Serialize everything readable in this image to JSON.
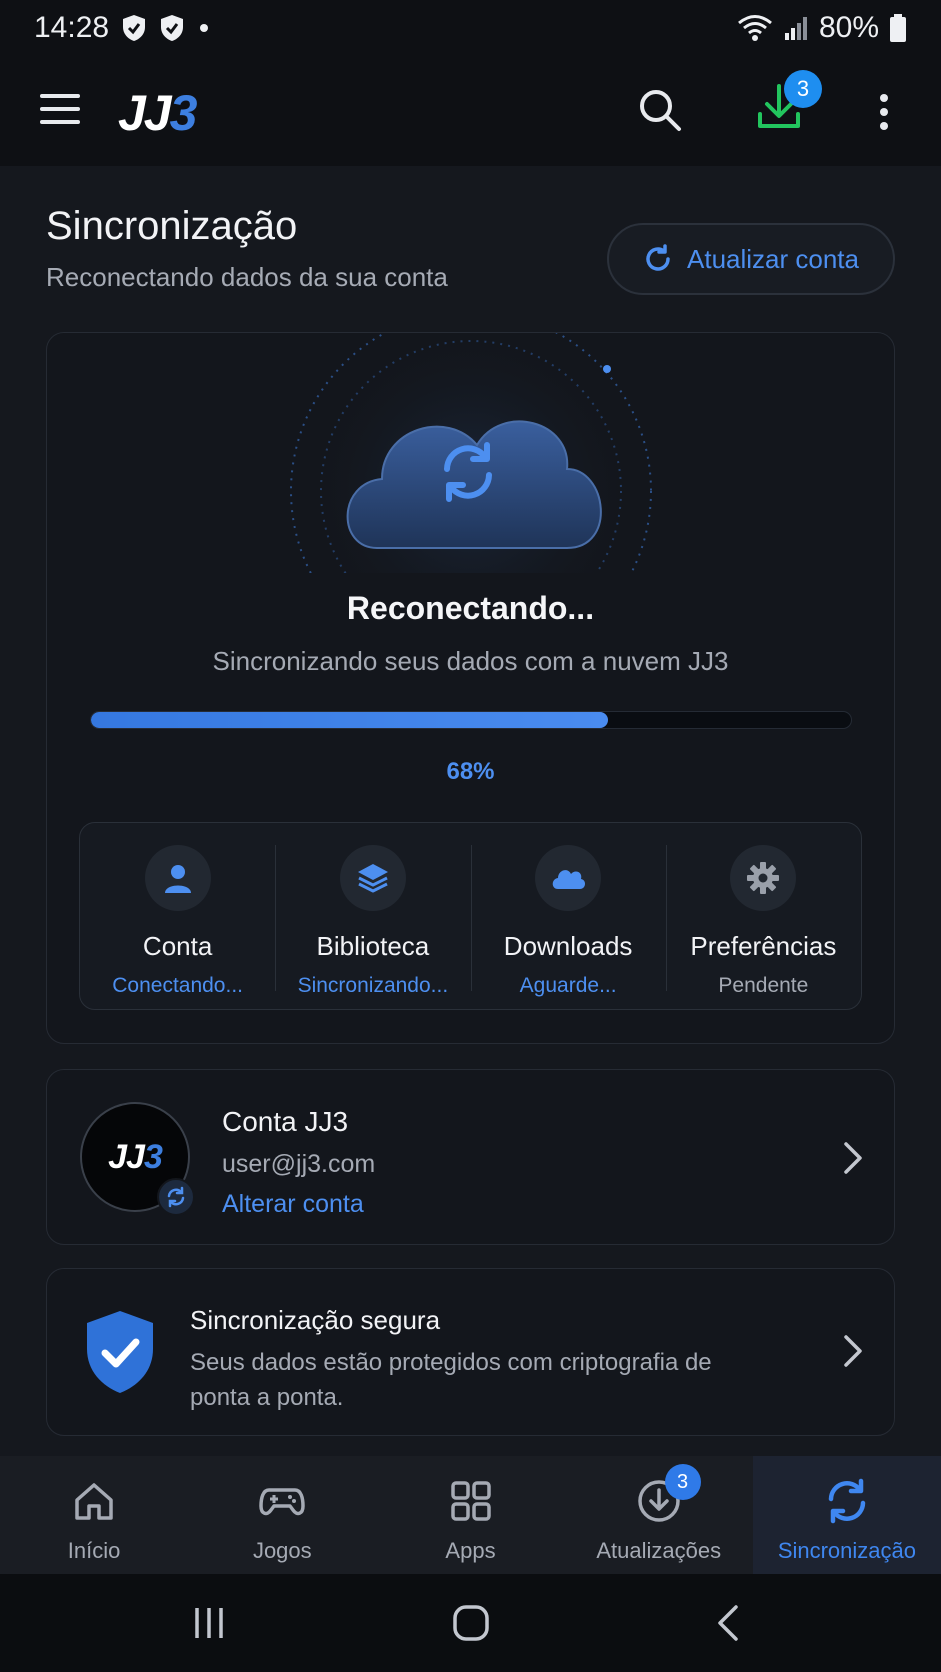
{
  "status_bar": {
    "time": "14:28",
    "battery": "80%"
  },
  "app_bar": {
    "logo_white": "JJ",
    "logo_blue": "3",
    "downloads_badge": "3"
  },
  "header": {
    "title": "Sincronização",
    "subtitle": "Reconectando dados da sua conta",
    "refresh_label": "Atualizar conta"
  },
  "sync": {
    "title": "Reconectando...",
    "description": "Sincronizando seus dados com a nuvem JJ3",
    "progress": 0.68,
    "progress_label": "68%",
    "items": [
      {
        "label": "Conta",
        "state": "Conectando...",
        "icon": "user-icon"
      },
      {
        "label": "Biblioteca",
        "state": "Sincronizando...",
        "icon": "layers-icon"
      },
      {
        "label": "Downloads",
        "state": "Aguarde...",
        "icon": "cloud-icon"
      },
      {
        "label": "Preferências",
        "state": "Pendente",
        "icon": "gear-icon"
      }
    ]
  },
  "account": {
    "avatar_white": "JJ",
    "avatar_blue": "3",
    "name": "Conta JJ3",
    "email": "user@jj3.com",
    "change_label": "Alterar conta"
  },
  "secure": {
    "title": "Sincronização segura",
    "description": "Seus dados estão protegidos com criptografia de ponta a ponta."
  },
  "bottom_nav": {
    "items": [
      {
        "label": "Início",
        "icon": "home-icon"
      },
      {
        "label": "Jogos",
        "icon": "gamepad-icon"
      },
      {
        "label": "Apps",
        "icon": "apps-grid-icon"
      },
      {
        "label": "Atualizações",
        "icon": "download-circle-icon",
        "badge": "3"
      },
      {
        "label": "Sincronização",
        "icon": "sync-icon",
        "active": true
      }
    ]
  },
  "colors": {
    "accent": "#3f87f0",
    "background": "#15181e",
    "download_green": "#22c55e"
  }
}
